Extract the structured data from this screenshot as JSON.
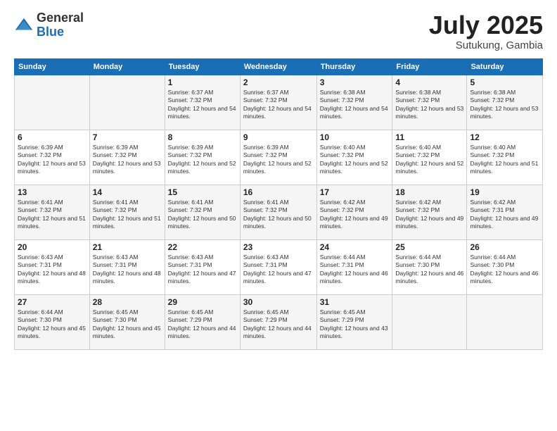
{
  "logo": {
    "general": "General",
    "blue": "Blue"
  },
  "title": "July 2025",
  "location": "Sutukung, Gambia",
  "weekdays": [
    "Sunday",
    "Monday",
    "Tuesday",
    "Wednesday",
    "Thursday",
    "Friday",
    "Saturday"
  ],
  "weeks": [
    [
      {
        "day": "",
        "info": ""
      },
      {
        "day": "",
        "info": ""
      },
      {
        "day": "1",
        "info": "Sunrise: 6:37 AM\nSunset: 7:32 PM\nDaylight: 12 hours and 54 minutes."
      },
      {
        "day": "2",
        "info": "Sunrise: 6:37 AM\nSunset: 7:32 PM\nDaylight: 12 hours and 54 minutes."
      },
      {
        "day": "3",
        "info": "Sunrise: 6:38 AM\nSunset: 7:32 PM\nDaylight: 12 hours and 54 minutes."
      },
      {
        "day": "4",
        "info": "Sunrise: 6:38 AM\nSunset: 7:32 PM\nDaylight: 12 hours and 53 minutes."
      },
      {
        "day": "5",
        "info": "Sunrise: 6:38 AM\nSunset: 7:32 PM\nDaylight: 12 hours and 53 minutes."
      }
    ],
    [
      {
        "day": "6",
        "info": "Sunrise: 6:39 AM\nSunset: 7:32 PM\nDaylight: 12 hours and 53 minutes."
      },
      {
        "day": "7",
        "info": "Sunrise: 6:39 AM\nSunset: 7:32 PM\nDaylight: 12 hours and 53 minutes."
      },
      {
        "day": "8",
        "info": "Sunrise: 6:39 AM\nSunset: 7:32 PM\nDaylight: 12 hours and 52 minutes."
      },
      {
        "day": "9",
        "info": "Sunrise: 6:39 AM\nSunset: 7:32 PM\nDaylight: 12 hours and 52 minutes."
      },
      {
        "day": "10",
        "info": "Sunrise: 6:40 AM\nSunset: 7:32 PM\nDaylight: 12 hours and 52 minutes."
      },
      {
        "day": "11",
        "info": "Sunrise: 6:40 AM\nSunset: 7:32 PM\nDaylight: 12 hours and 52 minutes."
      },
      {
        "day": "12",
        "info": "Sunrise: 6:40 AM\nSunset: 7:32 PM\nDaylight: 12 hours and 51 minutes."
      }
    ],
    [
      {
        "day": "13",
        "info": "Sunrise: 6:41 AM\nSunset: 7:32 PM\nDaylight: 12 hours and 51 minutes."
      },
      {
        "day": "14",
        "info": "Sunrise: 6:41 AM\nSunset: 7:32 PM\nDaylight: 12 hours and 51 minutes."
      },
      {
        "day": "15",
        "info": "Sunrise: 6:41 AM\nSunset: 7:32 PM\nDaylight: 12 hours and 50 minutes."
      },
      {
        "day": "16",
        "info": "Sunrise: 6:41 AM\nSunset: 7:32 PM\nDaylight: 12 hours and 50 minutes."
      },
      {
        "day": "17",
        "info": "Sunrise: 6:42 AM\nSunset: 7:32 PM\nDaylight: 12 hours and 49 minutes."
      },
      {
        "day": "18",
        "info": "Sunrise: 6:42 AM\nSunset: 7:32 PM\nDaylight: 12 hours and 49 minutes."
      },
      {
        "day": "19",
        "info": "Sunrise: 6:42 AM\nSunset: 7:31 PM\nDaylight: 12 hours and 49 minutes."
      }
    ],
    [
      {
        "day": "20",
        "info": "Sunrise: 6:43 AM\nSunset: 7:31 PM\nDaylight: 12 hours and 48 minutes."
      },
      {
        "day": "21",
        "info": "Sunrise: 6:43 AM\nSunset: 7:31 PM\nDaylight: 12 hours and 48 minutes."
      },
      {
        "day": "22",
        "info": "Sunrise: 6:43 AM\nSunset: 7:31 PM\nDaylight: 12 hours and 47 minutes."
      },
      {
        "day": "23",
        "info": "Sunrise: 6:43 AM\nSunset: 7:31 PM\nDaylight: 12 hours and 47 minutes."
      },
      {
        "day": "24",
        "info": "Sunrise: 6:44 AM\nSunset: 7:31 PM\nDaylight: 12 hours and 46 minutes."
      },
      {
        "day": "25",
        "info": "Sunrise: 6:44 AM\nSunset: 7:30 PM\nDaylight: 12 hours and 46 minutes."
      },
      {
        "day": "26",
        "info": "Sunrise: 6:44 AM\nSunset: 7:30 PM\nDaylight: 12 hours and 46 minutes."
      }
    ],
    [
      {
        "day": "27",
        "info": "Sunrise: 6:44 AM\nSunset: 7:30 PM\nDaylight: 12 hours and 45 minutes."
      },
      {
        "day": "28",
        "info": "Sunrise: 6:45 AM\nSunset: 7:30 PM\nDaylight: 12 hours and 45 minutes."
      },
      {
        "day": "29",
        "info": "Sunrise: 6:45 AM\nSunset: 7:29 PM\nDaylight: 12 hours and 44 minutes."
      },
      {
        "day": "30",
        "info": "Sunrise: 6:45 AM\nSunset: 7:29 PM\nDaylight: 12 hours and 44 minutes."
      },
      {
        "day": "31",
        "info": "Sunrise: 6:45 AM\nSunset: 7:29 PM\nDaylight: 12 hours and 43 minutes."
      },
      {
        "day": "",
        "info": ""
      },
      {
        "day": "",
        "info": ""
      }
    ]
  ]
}
